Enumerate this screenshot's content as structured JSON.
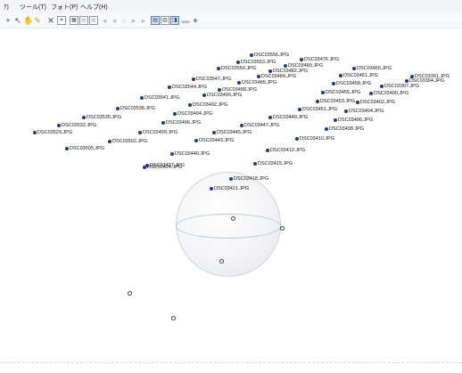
{
  "menu": [
    "ｱ)",
    "ツール(T)",
    "フォト(P)",
    "ヘルプ(H)"
  ],
  "toolbar_icons": [
    "plus-icon",
    "select-arrow-icon",
    "pan-hand-icon",
    "pencil-icon",
    "delete-x-icon",
    "crop-icon",
    "grid-view-icon",
    "grid-view-2-icon",
    "grid-view-3-icon",
    "prev-icon",
    "back-icon",
    "circle-icon",
    "forward-icon",
    "next-icon",
    "view-mode-1-icon",
    "view-mode-2-icon",
    "view-mode-3-icon",
    "minus-icon",
    "crosshair-plus-icon"
  ],
  "photos": [
    "DSC03529.JPG",
    "DSC03532.JPG",
    "DSC03535.JPG",
    "DSC03538.JPG",
    "DSC03541.JPG",
    "DSC03544.JPG",
    "DSC03547.JPG",
    "DSC03550.JPG",
    "DSC03553.JPG",
    "DSC03556.JPG",
    "DSC03505.JPG",
    "DSC03502.JPG",
    "DSC03499.JPG",
    "DSC03496.JPG",
    "DSC03494.JPG",
    "DSC03492.JPG",
    "DSC03490.JPG",
    "DSC03488.JPG",
    "DSC03485.JPG",
    "DSC03484.JPG",
    "DSC03482.JPG",
    "DSC03480.JPG",
    "DSC03476.JPG",
    "DSC03443.JPG",
    "DSC03445.JPG",
    "DSC03447.JPG",
    "DSC03449.JPG",
    "DSC03451.JPG",
    "DSC03453.JPG",
    "DSC03455.JPG",
    "DSC03458.JPG",
    "DSC03461.JPG",
    "DSC03465.JPG",
    "DSC03410.JPG",
    "DSC03408.JPG",
    "DSC03406.JPG",
    "DSC03404.JPG",
    "DSC03402.JPG",
    "DSC03400.JPG",
    "DSC03397.JPG",
    "DSC03394.JPG",
    "DSC03391.JPG",
    "DSC03440.JPG",
    "DSC03412.JPG",
    "DSC03415.JPG",
    "DSC03418.JPG",
    "DSC03421.JPG",
    "DSC03424.JPG",
    "DSC03427.JPG"
  ]
}
